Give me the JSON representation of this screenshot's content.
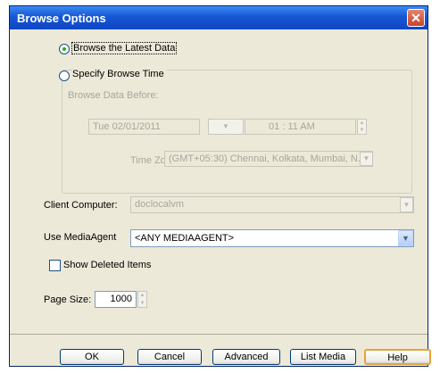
{
  "window": {
    "title": "Browse Options",
    "close_icon": "close-icon"
  },
  "browse": {
    "latest_label": "Browse the Latest Data",
    "specify_label": "Specify Browse Time",
    "before_label": "Browse Data Before:",
    "date_value": "Tue 02/01/2011",
    "time_hour": "01",
    "time_sep": ":",
    "time_rest": "11 AM",
    "timezone_label": "Time Zone:",
    "timezone_value": "(GMT+05:30) Chennai, Kolkata, Mumbai, N..."
  },
  "client": {
    "label": "Client Computer:",
    "value": "doclocalvm"
  },
  "media_agent": {
    "label": "Use MediaAgent",
    "value": "<ANY MEDIAAGENT>"
  },
  "show_deleted": {
    "label": "Show Deleted Items"
  },
  "page_size": {
    "label": "Page Size:",
    "value": "1000"
  },
  "buttons": {
    "ok": "OK",
    "cancel": "Cancel",
    "advanced": "Advanced",
    "list_media": "List Media",
    "help": "Help"
  },
  "glyphs": {
    "close": "✕",
    "arrow_down": "▼",
    "spin_up": "▲",
    "spin_down": "▼"
  },
  "colors": {
    "titlebar": "#1756d3",
    "dialog_bg": "#ece9d8",
    "radio_dot": "#20b020",
    "default_button_border": "#e6a43a"
  }
}
